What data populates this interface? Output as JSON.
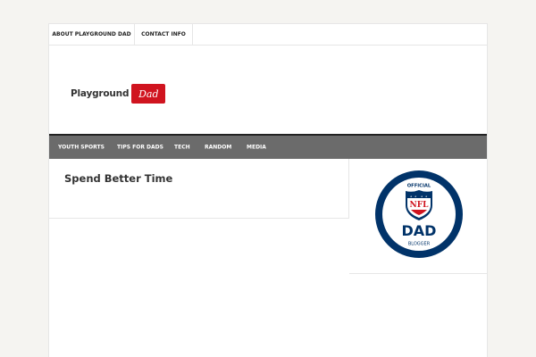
{
  "topbar": {
    "links": [
      {
        "label": "ABOUT PLAYGROUND DAD"
      },
      {
        "label": "CONTACT INFO"
      }
    ]
  },
  "header": {
    "logo_word": "Playground",
    "logo_badge": "Dad"
  },
  "nav": {
    "items": [
      {
        "label": "YOUTH SPORTS"
      },
      {
        "label": "TIPS FOR DADS"
      },
      {
        "label": "TECH"
      },
      {
        "label": "RANDOM"
      },
      {
        "label": "MEDIA"
      }
    ]
  },
  "main": {
    "title": "Spend Better Time"
  },
  "sidebar": {
    "badge": {
      "top_text": "OFFICIAL",
      "shield_text": "NFL",
      "main_text": "DAD",
      "bottom_text": "BLOGGER"
    }
  },
  "colors": {
    "page_bg": "#f5f4f1",
    "nav_bg": "#6b6b6b",
    "logo_red": "#d0141f",
    "nfl_blue": "#013369"
  }
}
